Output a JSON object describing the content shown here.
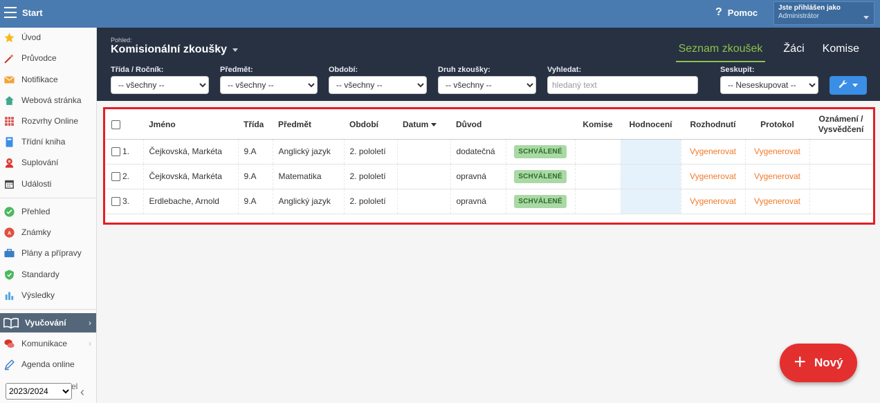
{
  "topbar": {
    "app_title": "Start",
    "help_label": "Pomoc",
    "user_line1": "Jste přihlášen jako",
    "user_line2": "Administrátor"
  },
  "sidebar": {
    "items": [
      {
        "label": "Úvod",
        "icon": "star-icon"
      },
      {
        "label": "Průvodce",
        "icon": "wand-icon"
      },
      {
        "label": "Notifikace",
        "icon": "envelope-icon"
      },
      {
        "label": "Webová stránka",
        "icon": "house-icon"
      },
      {
        "label": "Rozvrhy Online",
        "icon": "calendar-grid-icon"
      },
      {
        "label": "Třídní kniha",
        "icon": "book-icon"
      },
      {
        "label": "Suplování",
        "icon": "person-icon"
      },
      {
        "label": "Události",
        "icon": "calendar-icon"
      },
      {
        "label": "Přehled",
        "icon": "check-circle-icon"
      },
      {
        "label": "Známky",
        "icon": "grade-icon"
      },
      {
        "label": "Plány a přípravy",
        "icon": "briefcase-icon"
      },
      {
        "label": "Standardy",
        "icon": "shield-icon"
      },
      {
        "label": "Výsledky",
        "icon": "bar-chart-icon"
      },
      {
        "label": "Vyučování",
        "icon": "open-book-icon"
      },
      {
        "label": "Komunikace",
        "icon": "chat-icon"
      },
      {
        "label": "Agenda online",
        "icon": "pencil-icon"
      }
    ],
    "cut_label_fragment": "el",
    "year_value": "2023/2024"
  },
  "header": {
    "view_label": "Pohled:",
    "view_title": "Komisionální zkoušky",
    "tabs": [
      "Seznam zkoušek",
      "Žáci",
      "Komise"
    ],
    "filters": {
      "class_label": "Třída / Ročník:",
      "class_value": "-- všechny --",
      "subject_label": "Předmět:",
      "subject_value": "-- všechny --",
      "period_label": "Období:",
      "period_value": "-- všechny --",
      "type_label": "Druh zkoušky:",
      "type_value": "-- všechny --",
      "search_label": "Vyhledat:",
      "search_placeholder": "hledaný text",
      "group_label": "Seskupit:",
      "group_value": "-- Neseskupovat --"
    }
  },
  "table": {
    "columns": {
      "name": "Jméno",
      "class": "Třída",
      "subject": "Předmět",
      "period": "Období",
      "date": "Datum",
      "reason": "Důvod",
      "committee": "Komise",
      "grading": "Hodnocení",
      "decision": "Rozhodnutí",
      "protocol": "Protokol",
      "certificate": "Oznámení / Vysvědčení"
    },
    "rows": [
      {
        "num": "1.",
        "name": "Čejkovská, Markéta",
        "class": "9.A",
        "subject": "Anglický jazyk",
        "period": "2. pololetí",
        "date": "",
        "reason": "dodatečná",
        "status": "SCHVÁLENÉ",
        "committee": "",
        "grading": "",
        "decision": "Vygenerovat",
        "protocol": "Vygenerovat",
        "certificate": ""
      },
      {
        "num": "2.",
        "name": "Čejkovská, Markéta",
        "class": "9.A",
        "subject": "Matematika",
        "period": "2. pololetí",
        "date": "",
        "reason": "opravná",
        "status": "SCHVÁLENÉ",
        "committee": "",
        "grading": "",
        "decision": "Vygenerovat",
        "protocol": "Vygenerovat",
        "certificate": ""
      },
      {
        "num": "3.",
        "name": "Erdlebache, Arnold",
        "class": "9.A",
        "subject": "Anglický jazyk",
        "period": "2. pololetí",
        "date": "",
        "reason": "opravná",
        "status": "SCHVÁLENÉ",
        "committee": "",
        "grading": "",
        "decision": "Vygenerovat",
        "protocol": "Vygenerovat",
        "certificate": ""
      }
    ]
  },
  "new_button_label": "Nový",
  "colors": {
    "topbar": "#4a7bb0",
    "header": "#273142",
    "active_tab": "#8bc34a",
    "highlight_border": "#e31e24",
    "link_orange": "#f07a2a",
    "badge_green": "#a9d9a4",
    "new_button": "#e3302f"
  }
}
